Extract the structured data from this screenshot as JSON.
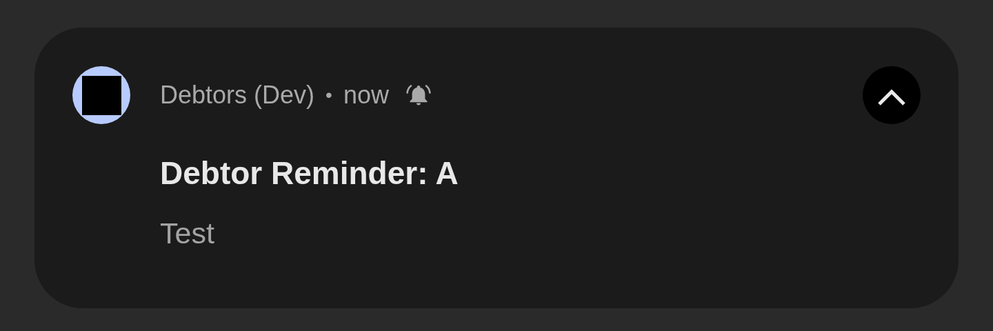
{
  "notification": {
    "app_name": "Debtors (Dev)",
    "separator": "•",
    "time": "now",
    "title": "Debtor Reminder: A",
    "body": "Test",
    "expanded": true
  }
}
